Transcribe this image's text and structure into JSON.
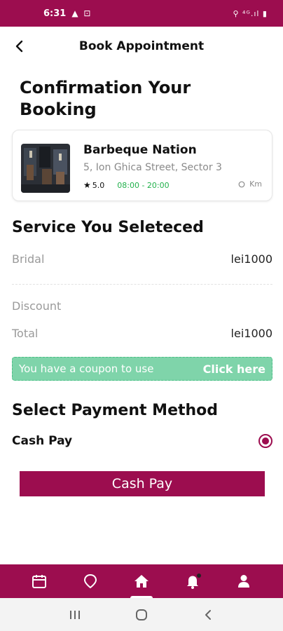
{
  "status_bar": {
    "time": "6:31",
    "left_icons": "▲ ⊡",
    "right_icons": "⚲ ⁴ᴳ.ıl ▮"
  },
  "header": {
    "title": "Book Appointment"
  },
  "page_title": "Confirmation Your Booking",
  "shop": {
    "name": "Barbeque Nation",
    "address": "5, Ion Ghica Street, Sector 3",
    "rating": "5.0",
    "hours": "08:00 - 20:00",
    "distance": "Km"
  },
  "services": {
    "title": "Service You Seleteced",
    "items": [
      {
        "name": "Bridal",
        "price": "lei1000"
      }
    ],
    "discount_label": "Discount",
    "total_label": "Total",
    "total_value": "lei1000"
  },
  "coupon": {
    "text": "You have a coupon to use",
    "action": "Click here"
  },
  "payment": {
    "title": "Select Payment Method",
    "option_label": "Cash Pay",
    "selected": true,
    "button_label": "Cash Pay"
  },
  "bottom_nav": {
    "items": [
      {
        "icon": "calendar-icon"
      },
      {
        "icon": "location-pin-icon"
      },
      {
        "icon": "home-icon",
        "active": true
      },
      {
        "icon": "bell-icon"
      },
      {
        "icon": "user-icon"
      }
    ]
  },
  "colors": {
    "brand": "#9c0d4f",
    "coupon_bg": "#7fd4aa",
    "hours_green": "#22b14c"
  }
}
